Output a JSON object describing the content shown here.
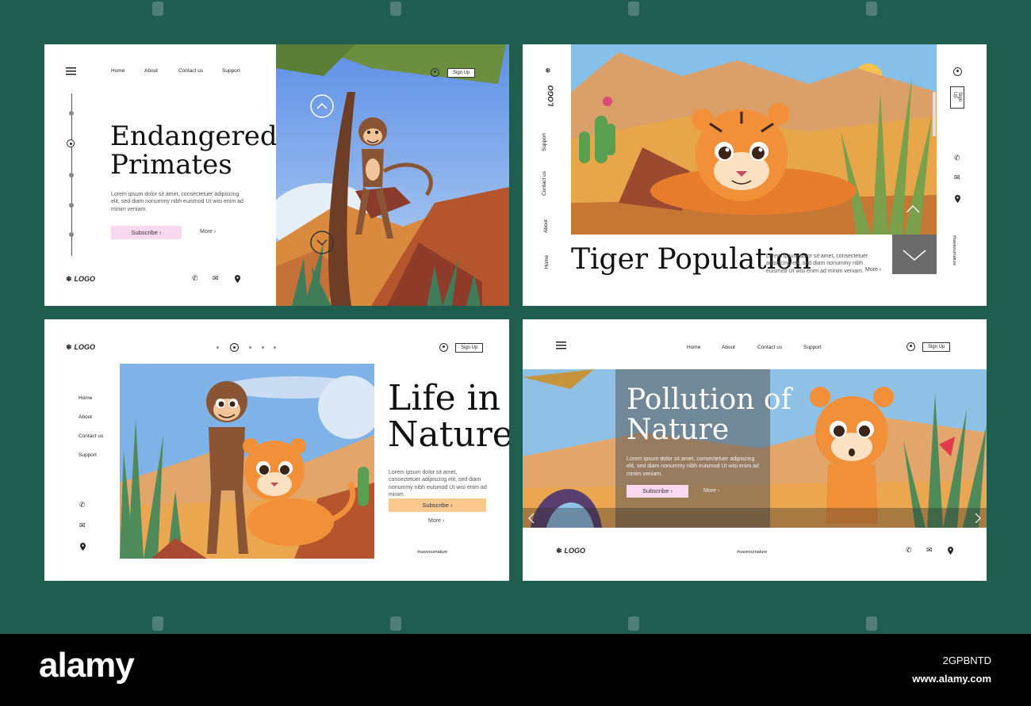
{
  "card1": {
    "nav": [
      "Home",
      "About",
      "Contact us",
      "Support"
    ],
    "signup": "Sign Up",
    "title_line1": "Endangered",
    "title_line2": "Primates",
    "lorem": "Lorem ipsum dolor sit amet, consectetuer adipiscing elit, sed diam nonummy nibh euismod Ut wisi enim ad minim veniam.",
    "subscribe": "Subscribe  ›",
    "more": "More  ›",
    "logo": "LOGO"
  },
  "card2": {
    "logo": "LOGO",
    "side_nav": [
      "Support",
      "Contact us",
      "About",
      "Home"
    ],
    "signup": "Sign Up",
    "title": "Tiger Population",
    "lorem": "Lorem ipsum dolor sit amet, consectetuer adipiscing elit, sed diam nonummy nibh euismod Ut wisi enim ad minim veniam.",
    "more": "More  ›",
    "hashtag": "#saveournature"
  },
  "card3": {
    "logo": "LOGO",
    "signup": "Sign Up",
    "side_nav": [
      "Home",
      "About",
      "Contact us",
      "Support"
    ],
    "title_line1": "Life in",
    "title_line2": "Nature",
    "lorem": "Lorem ipsum dolor sit amet, consectetuer adipiscing elit, sed diam nonummy nibh euismod Ut wisi enim ad minim",
    "subscribe": "Subscribe  ›",
    "more": "More  ›",
    "hashtag": "#saveournature"
  },
  "card4": {
    "nav": [
      "Home",
      "About",
      "Contact us",
      "Support"
    ],
    "signup": "Sign Up",
    "title_line1": "Pollution of",
    "title_line2": "Nature",
    "lorem": "Lorem ipsum dolor sit amet, consectetuer adipiscing elit, sed diam nonummy nibh euismod Ut wisi enim ad minim veniam.",
    "subscribe": "Subscribe  ›",
    "more": "More  ›",
    "logo": "LOGO",
    "hashtag": "#saveournature"
  },
  "watermark": {
    "brand": "alamy",
    "image_id": "2GPBNTD",
    "url": "www.alamy.com"
  },
  "colors": {
    "background": "#1f5d4f",
    "subscribe_pink": "#f9d9f0",
    "subscribe_orange": "#f9c98f",
    "sky": "#7fb3e8",
    "sand": "#e8a64a"
  }
}
